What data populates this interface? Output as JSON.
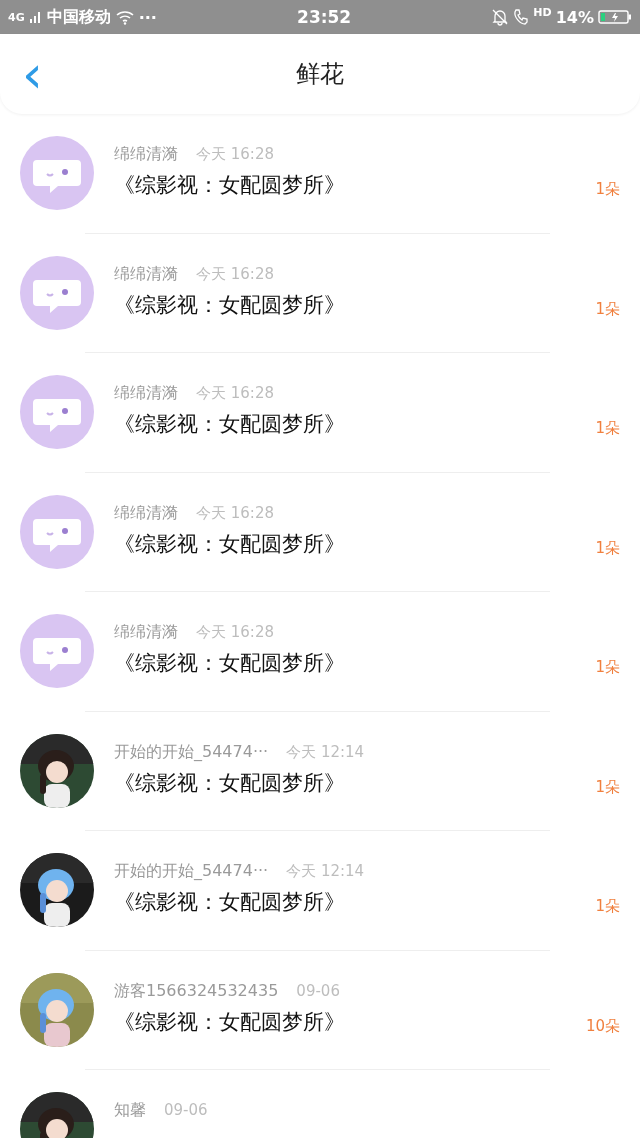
{
  "status_bar": {
    "network": "4G",
    "carrier": "中国移动",
    "more": "···",
    "time": "23:52",
    "hd": "HD",
    "battery": "14%"
  },
  "header": {
    "back": "‹",
    "title": "鲜花"
  },
  "items": [
    {
      "avatar": {
        "kind": "bubble"
      },
      "name": "绵绵清漪",
      "time": "今天 16:28",
      "title": "《综影视：女配圆梦所》",
      "count": "1朵"
    },
    {
      "avatar": {
        "kind": "bubble"
      },
      "name": "绵绵清漪",
      "time": "今天 16:28",
      "title": "《综影视：女配圆梦所》",
      "count": "1朵"
    },
    {
      "avatar": {
        "kind": "bubble"
      },
      "name": "绵绵清漪",
      "time": "今天 16:28",
      "title": "《综影视：女配圆梦所》",
      "count": "1朵"
    },
    {
      "avatar": {
        "kind": "bubble"
      },
      "name": "绵绵清漪",
      "time": "今天 16:28",
      "title": "《综影视：女配圆梦所》",
      "count": "1朵"
    },
    {
      "avatar": {
        "kind": "bubble"
      },
      "name": "绵绵清漪",
      "time": "今天 16:28",
      "title": "《综影视：女配圆梦所》",
      "count": "1朵"
    },
    {
      "name": "开始的开始_54474···",
      "time": "今天 12:14",
      "title": "《综影视：女配圆梦所》",
      "count": "1朵"
    },
    {
      "name": "开始的开始_54474···",
      "time": "今天 12:14",
      "title": "《综影视：女配圆梦所》",
      "count": "1朵"
    },
    {
      "name": "游客1566324532435",
      "time": "09-06",
      "title": "《综影视：女配圆梦所》",
      "count": "10朵"
    },
    {
      "name": "知馨",
      "time": "09-06"
    }
  ]
}
